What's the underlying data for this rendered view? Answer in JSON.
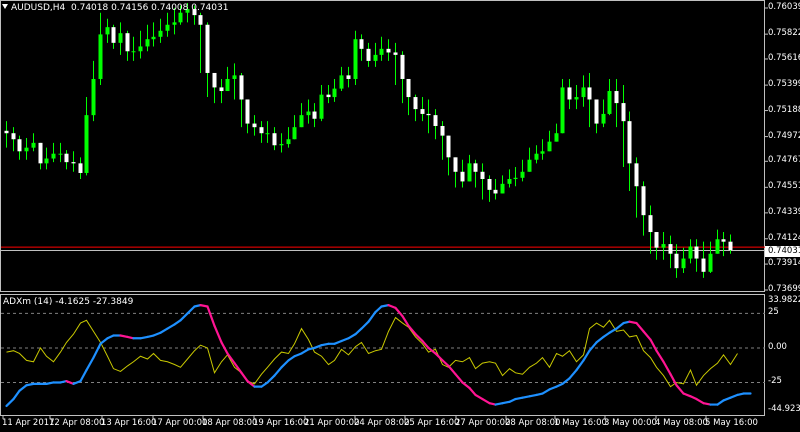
{
  "main_header": {
    "symbol": "AUDUSD,H4",
    "ohlc": "0.74018 0.74156 0.74008 0.74031"
  },
  "indicator_header": {
    "name": "ADXm (14)",
    "values": "-4.1625 -27.3849"
  },
  "current_price": "0.74031",
  "colors": {
    "background": "#000000",
    "bull_candle": "#00ff00",
    "bear_candle": "#ffffff",
    "bid_line": "#ff0000",
    "adx_up": "#1e90ff",
    "adx_down": "#ff1493",
    "signal": "#c8c800"
  },
  "time_axis": [
    "11 Apr 2017",
    "12 Apr 08:00",
    "13 Apr 16:00",
    "17 Apr 00:00",
    "18 Apr 08:00",
    "19 Apr 16:00",
    "21 Apr 00:00",
    "24 Apr 08:00",
    "25 Apr 16:00",
    "27 Apr 00:00",
    "28 Apr 08:00",
    "1 May 16:00",
    "3 May 00:00",
    "4 May 08:00",
    "5 May 16:00"
  ],
  "chart_data": [
    {
      "type": "candlestick",
      "title": "AUDUSD,H4",
      "ylim": [
        0.73699,
        0.76039
      ],
      "y_ticks": [
        "0.76039",
        "0.75822",
        "0.75616",
        "0.75399",
        "0.75188",
        "0.74972",
        "0.74767",
        "0.74551",
        "0.74339",
        "0.74124",
        "0.73914",
        "0.73699"
      ],
      "close": [
        0.75,
        0.7495,
        0.7485,
        0.7488,
        0.7492,
        0.7475,
        0.7479,
        0.7483,
        0.7483,
        0.7476,
        0.7475,
        0.7467,
        0.7515,
        0.7545,
        0.7582,
        0.7588,
        0.7575,
        0.7583,
        0.7568,
        0.7568,
        0.7572,
        0.7578,
        0.758,
        0.7585,
        0.759,
        0.7592,
        0.76,
        0.7603,
        0.7598,
        0.759,
        0.755,
        0.7538,
        0.7535,
        0.7545,
        0.7548,
        0.7528,
        0.7508,
        0.7505,
        0.75,
        0.75,
        0.749,
        0.7491,
        0.7495,
        0.7505,
        0.7515,
        0.7518,
        0.7512,
        0.7532,
        0.753,
        0.7537,
        0.7548,
        0.7545,
        0.7578,
        0.757,
        0.756,
        0.7565,
        0.757,
        0.7567,
        0.7565,
        0.7545,
        0.753,
        0.752,
        0.7516,
        0.7515,
        0.7506,
        0.7498,
        0.748,
        0.7468,
        0.746,
        0.7475,
        0.7468,
        0.7462,
        0.7453,
        0.745,
        0.7458,
        0.7462,
        0.7463,
        0.7468,
        0.7478,
        0.7483,
        0.7485,
        0.7493,
        0.75,
        0.7538,
        0.7528,
        0.753,
        0.7538,
        0.7528,
        0.7508,
        0.7516,
        0.7535,
        0.7525,
        0.751,
        0.7475,
        0.7456,
        0.7432,
        0.7418,
        0.7405,
        0.7408,
        0.74,
        0.7388,
        0.7396,
        0.7406,
        0.7396,
        0.7385,
        0.74,
        0.7412,
        0.741,
        0.7403
      ],
      "high": [
        0.751,
        0.7505,
        0.7498,
        0.7496,
        0.75,
        0.7492,
        0.7488,
        0.7492,
        0.7492,
        0.7486,
        0.7485,
        0.748,
        0.753,
        0.756,
        0.76,
        0.7595,
        0.759,
        0.7592,
        0.7585,
        0.758,
        0.7585,
        0.759,
        0.7592,
        0.7595,
        0.76,
        0.7604,
        0.7606,
        0.7608,
        0.7606,
        0.76,
        0.7592,
        0.755,
        0.7545,
        0.7555,
        0.7558,
        0.755,
        0.7525,
        0.7515,
        0.751,
        0.751,
        0.7505,
        0.75,
        0.7505,
        0.7515,
        0.7525,
        0.7528,
        0.7525,
        0.754,
        0.754,
        0.7545,
        0.7555,
        0.7555,
        0.7585,
        0.7582,
        0.7575,
        0.7575,
        0.758,
        0.7578,
        0.7575,
        0.7568,
        0.7545,
        0.7532,
        0.753,
        0.7528,
        0.752,
        0.751,
        0.7498,
        0.748,
        0.7478,
        0.7482,
        0.7478,
        0.7475,
        0.7465,
        0.7462,
        0.7465,
        0.747,
        0.7472,
        0.7478,
        0.7488,
        0.749,
        0.7495,
        0.7502,
        0.7508,
        0.7545,
        0.7545,
        0.754,
        0.7548,
        0.755,
        0.7528,
        0.7528,
        0.7545,
        0.7545,
        0.754,
        0.7518,
        0.748,
        0.746,
        0.744,
        0.7418,
        0.7418,
        0.7415,
        0.7408,
        0.7405,
        0.7412,
        0.7412,
        0.741,
        0.741,
        0.742,
        0.7418,
        0.7416
      ],
      "low": [
        0.7488,
        0.7485,
        0.7478,
        0.7478,
        0.7485,
        0.747,
        0.747,
        0.7476,
        0.7476,
        0.747,
        0.7468,
        0.7462,
        0.7465,
        0.751,
        0.754,
        0.7575,
        0.757,
        0.7565,
        0.756,
        0.756,
        0.7562,
        0.7568,
        0.7572,
        0.7575,
        0.758,
        0.7582,
        0.759,
        0.7592,
        0.759,
        0.755,
        0.753,
        0.7525,
        0.7525,
        0.7535,
        0.7528,
        0.7505,
        0.75,
        0.7498,
        0.7492,
        0.7492,
        0.7486,
        0.7484,
        0.7488,
        0.7495,
        0.7505,
        0.7508,
        0.7505,
        0.751,
        0.7525,
        0.7526,
        0.7535,
        0.7538,
        0.754,
        0.756,
        0.7555,
        0.7555,
        0.756,
        0.756,
        0.754,
        0.7525,
        0.7515,
        0.751,
        0.751,
        0.75,
        0.7495,
        0.7478,
        0.7465,
        0.7455,
        0.7455,
        0.746,
        0.7455,
        0.7445,
        0.7443,
        0.7445,
        0.745,
        0.7455,
        0.7456,
        0.746,
        0.747,
        0.7475,
        0.7478,
        0.7488,
        0.7495,
        0.75,
        0.752,
        0.752,
        0.7522,
        0.7505,
        0.75,
        0.7505,
        0.7515,
        0.7505,
        0.7472,
        0.7452,
        0.743,
        0.7415,
        0.74,
        0.7395,
        0.7395,
        0.7388,
        0.738,
        0.7384,
        0.7392,
        0.7385,
        0.738,
        0.7384,
        0.74,
        0.7398,
        0.74
      ],
      "bid_line": 0.74031,
      "secondary_line": 0.74055
    },
    {
      "type": "line",
      "title": "ADXm (14)",
      "ylim": [
        -44.9231,
        33.9822
      ],
      "y_ticks": [
        "33.9822",
        "25",
        "0.00",
        "-25",
        "-44.9231"
      ],
      "levels": [
        25,
        0,
        -25
      ],
      "series": [
        {
          "name": "-4.1625",
          "values": [
            -3,
            -2,
            -4,
            -9,
            -10,
            0,
            -6,
            -10,
            -3,
            4,
            10,
            18,
            20,
            12,
            4,
            -6,
            -15,
            -17,
            -13,
            -10,
            -6,
            -8,
            -4,
            -9,
            -10,
            -12,
            -14,
            -8,
            -2,
            2,
            0,
            -18,
            -10,
            -5,
            -14,
            -18,
            -24,
            -26,
            -19,
            -14,
            -8,
            -3,
            -4,
            3,
            14,
            6,
            -3,
            -6,
            -12,
            -9,
            -1,
            -5,
            1,
            4,
            -4,
            -2,
            -1,
            12,
            22,
            18,
            15,
            8,
            3,
            -3,
            -1,
            -12,
            -14,
            -9,
            -10,
            -7,
            -15,
            -11,
            -10,
            -11,
            -20,
            -15,
            -18,
            -19,
            -14,
            -11,
            -7,
            -14,
            -4,
            -6,
            -2,
            -10,
            -5,
            14,
            18,
            15,
            20,
            12,
            13,
            8,
            9,
            -2,
            -7,
            -14,
            -20,
            -28,
            -25,
            -26,
            -16,
            -27,
            -20,
            -15,
            -11,
            -5,
            -12,
            -4
          ]
        },
        {
          "name": "-27.3849",
          "values": [
            -42,
            -37,
            -31,
            -27,
            -26,
            -26,
            -26,
            -25,
            -25,
            -24,
            -26,
            -24,
            -16,
            -7,
            3,
            7,
            9,
            9,
            8,
            7,
            7,
            8,
            9,
            11,
            14,
            17,
            20,
            25,
            30,
            31,
            30,
            16,
            4,
            -4,
            -11,
            -18,
            -24,
            -28,
            -28,
            -25,
            -20,
            -14,
            -9,
            -6,
            -4,
            -1,
            0,
            2,
            3,
            3,
            5,
            7,
            10,
            14,
            19,
            26,
            30,
            31,
            29,
            23,
            16,
            10,
            5,
            0,
            -4,
            -9,
            -13,
            -19,
            -25,
            -29,
            -34,
            -37,
            -40,
            -41,
            -40,
            -39,
            -37,
            -36,
            -35,
            -34,
            -33,
            -30,
            -28,
            -26,
            -22,
            -16,
            -9,
            -2,
            4,
            8,
            11,
            14,
            18,
            19,
            18,
            12,
            6,
            -2,
            -10,
            -19,
            -27,
            -33,
            -35,
            -37,
            -40,
            -41,
            -41,
            -38,
            -36,
            -34,
            -33,
            -33
          ]
        }
      ]
    }
  ]
}
